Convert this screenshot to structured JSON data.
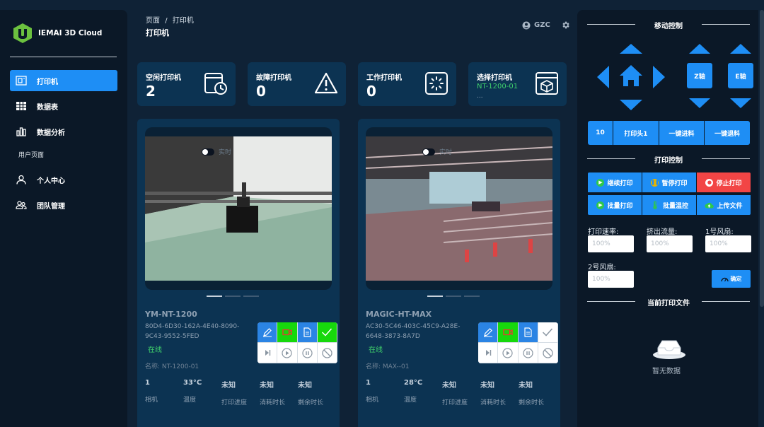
{
  "app": {
    "name": "IEMAI 3D Cloud"
  },
  "nav": [
    {
      "label": "打印机",
      "icon": "printer-icon",
      "active": true
    },
    {
      "label": "数据表",
      "icon": "table-icon"
    },
    {
      "label": "数据分析",
      "icon": "bar-chart-icon"
    }
  ],
  "nav_section": "用户页面",
  "nav2": [
    {
      "label": "个人中心",
      "icon": "user-icon"
    },
    {
      "label": "团队管理",
      "icon": "team-icon"
    }
  ],
  "breadcrumb": {
    "root": "页面",
    "sep": "/",
    "current": "打印机"
  },
  "page_title": "打印机",
  "user": {
    "name": "GZC"
  },
  "stats": [
    {
      "label": "空闲打印机",
      "value": "2"
    },
    {
      "label": "故障打印机",
      "value": "0"
    },
    {
      "label": "工作打印机",
      "value": "0"
    },
    {
      "label": "选择打印机",
      "value": "NT-1200-01",
      "sub": "..."
    }
  ],
  "printers": [
    {
      "live_label": "实时",
      "name": "YM-NT-1200",
      "uuid": "80D4-6D30-162A-4E40-8090-9C43-9552-5FED",
      "status": "在线",
      "alias": "名称:  NT-1200-01",
      "metrics": [
        {
          "value": "1",
          "label": "相机"
        },
        {
          "value": "33°C",
          "label": "温度"
        },
        {
          "value": "未知",
          "label": "打印进度"
        },
        {
          "value": "未知",
          "label": "消耗时长"
        },
        {
          "value": "未知",
          "label": "剩余时长"
        }
      ]
    },
    {
      "live_label": "实时",
      "name": "MAGIC-HT-MAX",
      "uuid": "AC30-5C46-403C-45C9-A28E-6648-3873-8A7D",
      "status": "在线",
      "alias": "名称:  MAX--01",
      "metrics": [
        {
          "value": "1",
          "label": "相机"
        },
        {
          "value": "28°C",
          "label": "温度"
        },
        {
          "value": "未知",
          "label": "打印进度"
        },
        {
          "value": "未知",
          "label": "消耗时长"
        },
        {
          "value": "未知",
          "label": "剩余时长"
        }
      ]
    }
  ],
  "right_panel": {
    "motion_title": "移动控制",
    "z_axis": "Z轴",
    "e_axis": "E轴",
    "row": [
      "10",
      "打印头1",
      "一键进料",
      "一键退料"
    ],
    "print_title": "打印控制",
    "controls": [
      {
        "label": "继续打印",
        "icon": "resume-icon"
      },
      {
        "label": "暂停打印",
        "icon": "pause-icon"
      },
      {
        "label": "停止打印",
        "icon": "stop-icon"
      },
      {
        "label": "批量打印",
        "icon": "batch-print-icon"
      },
      {
        "label": "批量温控",
        "icon": "thermometer-icon"
      },
      {
        "label": "上传文件",
        "icon": "cloud-upload-icon"
      }
    ],
    "fields": [
      {
        "label": "打印速率:",
        "placeholder": "100%"
      },
      {
        "label": "挤出流量:",
        "placeholder": "100%"
      },
      {
        "label": "1号风扇:",
        "placeholder": "100%"
      },
      {
        "label": "2号风扇:",
        "placeholder": "100%"
      }
    ],
    "confirm": "确定",
    "files_title": "当前打印文件",
    "empty": "暂无数据"
  },
  "colors": {
    "accent": "#1e8ef5",
    "panel": "#0c3352",
    "sidebar": "#0b1827",
    "online": "#3fd06c",
    "danger": "#f24545"
  }
}
